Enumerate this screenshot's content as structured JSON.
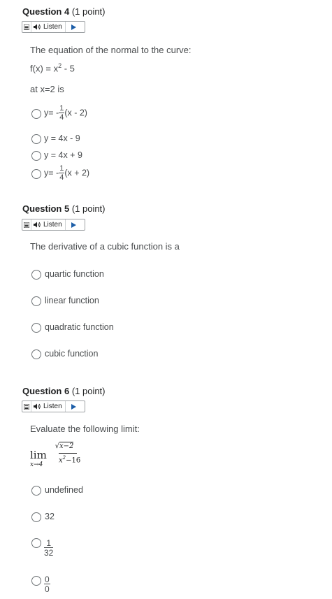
{
  "listen_label": "Listen",
  "q4": {
    "title_bold": "Question 4",
    "title_points": "(1 point)",
    "stem_line1": "The equation of the normal to the curve:",
    "stem_fx_left": "f(x) = x",
    "stem_fx_exp": "2",
    "stem_fx_right": " - 5",
    "stem_line3": "at x=2 is",
    "opt_a_prefix": "y= -",
    "opt_a_num": "1",
    "opt_a_den": "4",
    "opt_a_suffix": "(x - 2)",
    "opt_b": "y = 4x - 9",
    "opt_c": "y = 4x + 9",
    "opt_d_prefix": "y= -",
    "opt_d_num": "1",
    "opt_d_den": "4",
    "opt_d_suffix": "(x + 2)"
  },
  "q5": {
    "title_bold": "Question 5",
    "title_points": "(1 point)",
    "stem": "The derivative of a cubic function is a",
    "options": [
      "quartic function",
      "linear function",
      "quadratic function",
      "cubic function"
    ]
  },
  "q6": {
    "title_bold": "Question 6",
    "title_points": "(1 point)",
    "stem": "Evaluate the following limit:",
    "lim_word": "lim",
    "lim_sub": "x→4",
    "lim_num": "x−2",
    "lim_den_base": "x",
    "lim_den_exp": "2",
    "lim_den_rest": "−16",
    "opt_a": "undefined",
    "opt_b": "32",
    "opt_c_num": "1",
    "opt_c_den": "32",
    "opt_d_num": "0",
    "opt_d_den": "0"
  }
}
